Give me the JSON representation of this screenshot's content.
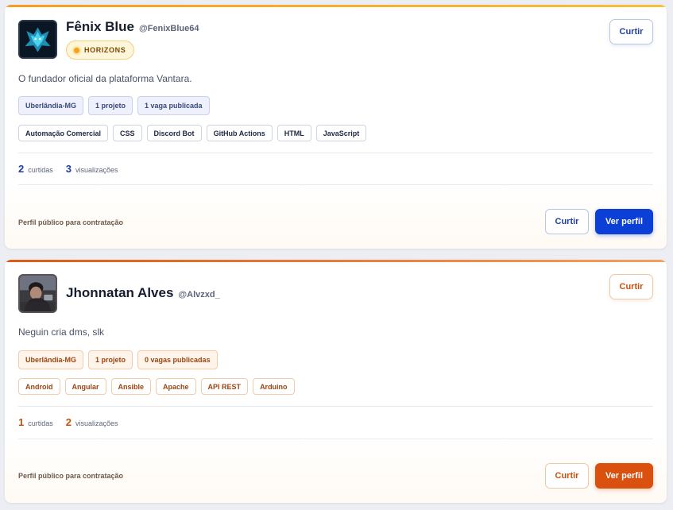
{
  "cards": [
    {
      "name": "Fênix Blue",
      "handle": "@FenixBlue64",
      "badge": "HORIZONS",
      "top_like_label": "Curtir",
      "bio": "O fundador oficial da plataforma Vantara.",
      "info_chips": [
        "Uberlândia-MG",
        "1 projeto",
        "1 vaga publicada"
      ],
      "skills": [
        "Automação Comercial",
        "CSS",
        "Discord Bot",
        "GitHub Actions",
        "HTML",
        "JavaScript"
      ],
      "likes_count": "2",
      "likes_label": "curtidas",
      "views_count": "3",
      "views_label": "visualizações",
      "footer_note": "Perfil público para contratação",
      "like_label": "Curtir",
      "view_label": "Ver perfil",
      "accent": "#0c3fd6"
    },
    {
      "name": "Jhonnatan Alves",
      "handle": "@Alvzxd_",
      "top_like_label": "Curtir",
      "bio": "Neguin cria dms, slk",
      "info_chips": [
        "Uberlândia-MG",
        "1 projeto",
        "0 vagas publicadas"
      ],
      "skills": [
        "Android",
        "Angular",
        "Ansible",
        "Apache",
        "API REST",
        "Arduino"
      ],
      "likes_count": "1",
      "likes_label": "curtidas",
      "views_count": "2",
      "views_label": "visualizações",
      "footer_note": "Perfil público para contratação",
      "like_label": "Curtir",
      "view_label": "Ver perfil",
      "accent": "#d9500f"
    }
  ]
}
